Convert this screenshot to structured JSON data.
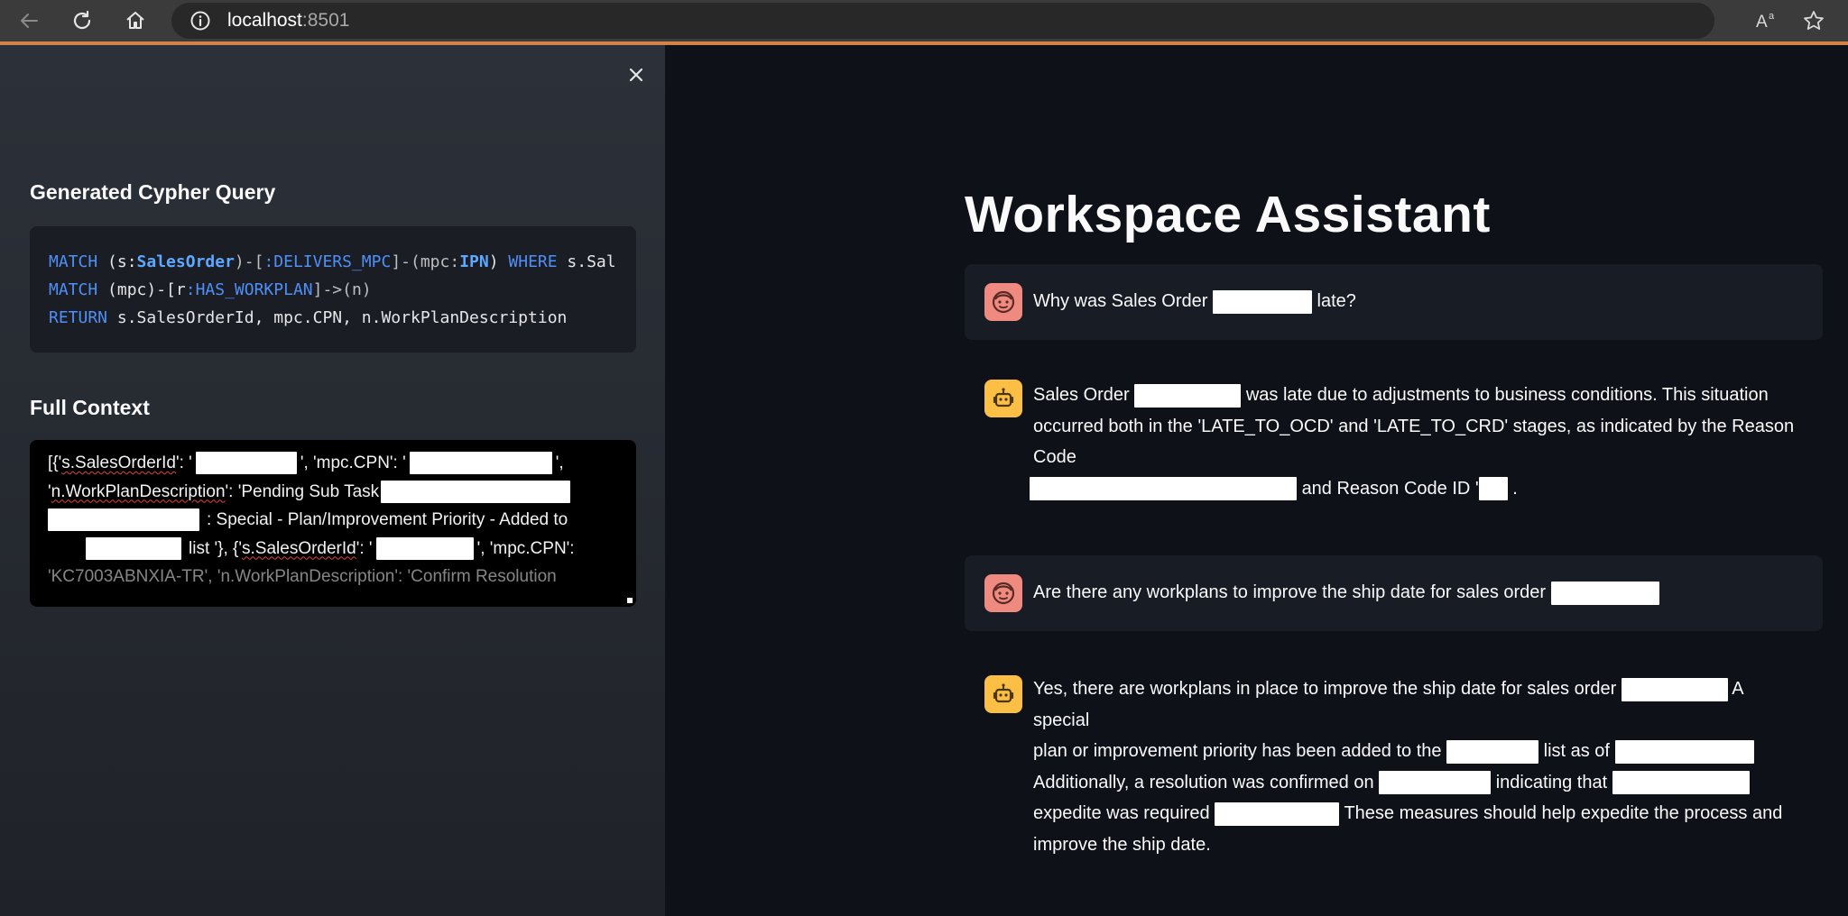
{
  "browser": {
    "url_host": "localhost",
    "url_port": ":8501",
    "icons": [
      "back-arrow-icon",
      "reload-icon",
      "home-icon",
      "info-icon",
      "read-aloud-icon",
      "favorite-star-icon"
    ]
  },
  "sidebar": {
    "close_icon": "close-icon",
    "query_heading": "Generated Cypher Query",
    "query_lines": [
      {
        "kw1": "MATCH",
        "a": " (s:",
        "label1": "SalesOrder",
        "b": ")-[",
        "rel1": ":DELIVERS_MPC",
        "c": "]-(mpc:",
        "label2": "IPN",
        "d": ") ",
        "kw2": "WHERE",
        "e": " s.Sal"
      },
      {
        "kw1": "MATCH",
        "a": " (mpc)-[r",
        "rel1": ":HAS_WORKPLAN",
        "b": "]->(n)"
      },
      {
        "kw1": "RETURN",
        "a": " s.SalesOrderId, mpc.CPN, n.WorkPlanDescription"
      }
    ],
    "context_heading": "Full Context",
    "context": {
      "l1a": "[{'",
      "l1b": "s.SalesOrderId",
      "l1c": "': '",
      "l1d": "', 'mpc.CPN': '",
      "l1e": "',",
      "l2a": "'",
      "l2b": "n.WorkPlanDescription",
      "l2c": "': 'Pending Sub Task",
      "l3a": ": Special - Plan/Improvement Priority - Added to",
      "l4a": "list '}, {'",
      "l4b": "s.SalesOrderId",
      "l4c": "': '",
      "l4d": "', 'mpc.CPN':",
      "l5a": "'KC7003ABNXIA-TR', 'n.WorkPlanDescription': 'Confirm Resolution"
    }
  },
  "main": {
    "title": "Workspace Assistant",
    "messages": [
      {
        "role": "user",
        "avatar_icon": "user-face-icon",
        "t1": "Why was Sales Order",
        "t2": "late?"
      },
      {
        "role": "assistant",
        "avatar_icon": "robot-icon",
        "t1": "Sales Order",
        "t2": "was late due to adjustments to business conditions. This situation",
        "t3": "occurred both in the 'LATE_TO_OCD' and 'LATE_TO_CRD' stages, as indicated by the Reason Code",
        "t4": "and Reason Code ID '",
        "t5": "."
      },
      {
        "role": "user",
        "avatar_icon": "user-face-icon",
        "t1": "Are there any workplans to improve the ship date for sales order"
      },
      {
        "role": "assistant",
        "avatar_icon": "robot-icon",
        "t1": "Yes, there are workplans in place to improve the ship date for sales order",
        "t2": "A special",
        "t3": "plan or improvement priority has been added to the",
        "t4": "list as of",
        "t5": "Additionally, a resolution was confirmed on",
        "t6": "indicating that",
        "t7": "expedite was required",
        "t8": "These measures should help expedite the process and",
        "t9": "improve the ship date."
      }
    ]
  }
}
